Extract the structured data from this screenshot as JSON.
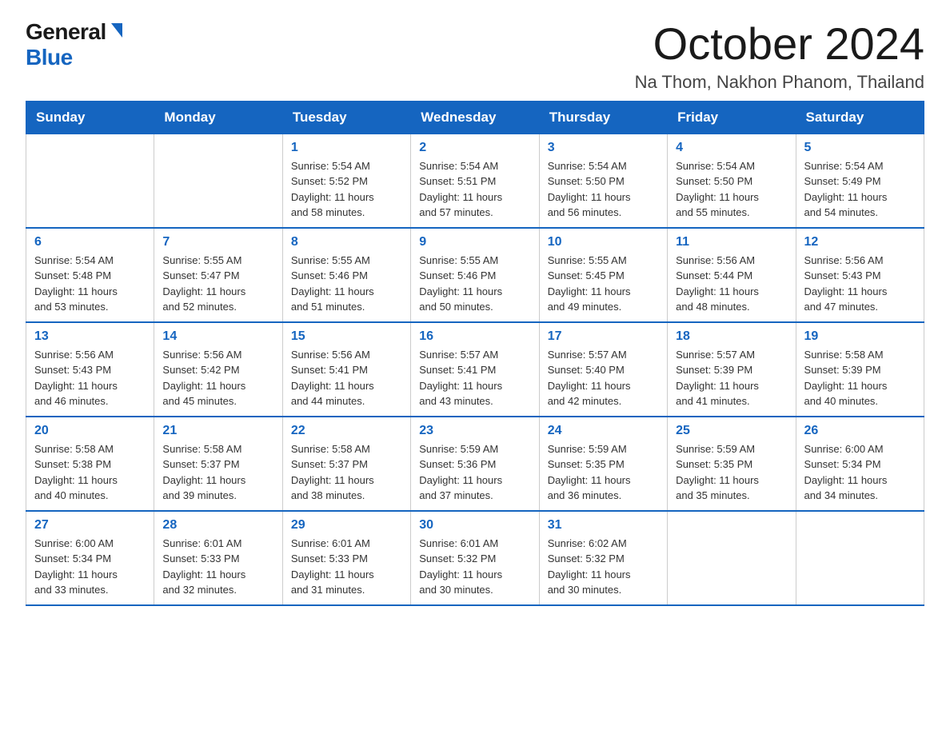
{
  "logo": {
    "general": "General",
    "blue": "Blue"
  },
  "header": {
    "month": "October 2024",
    "location": "Na Thom, Nakhon Phanom, Thailand"
  },
  "days_of_week": [
    "Sunday",
    "Monday",
    "Tuesday",
    "Wednesday",
    "Thursday",
    "Friday",
    "Saturday"
  ],
  "weeks": [
    [
      {
        "day": "",
        "info": ""
      },
      {
        "day": "",
        "info": ""
      },
      {
        "day": "1",
        "info": "Sunrise: 5:54 AM\nSunset: 5:52 PM\nDaylight: 11 hours\nand 58 minutes."
      },
      {
        "day": "2",
        "info": "Sunrise: 5:54 AM\nSunset: 5:51 PM\nDaylight: 11 hours\nand 57 minutes."
      },
      {
        "day": "3",
        "info": "Sunrise: 5:54 AM\nSunset: 5:50 PM\nDaylight: 11 hours\nand 56 minutes."
      },
      {
        "day": "4",
        "info": "Sunrise: 5:54 AM\nSunset: 5:50 PM\nDaylight: 11 hours\nand 55 minutes."
      },
      {
        "day": "5",
        "info": "Sunrise: 5:54 AM\nSunset: 5:49 PM\nDaylight: 11 hours\nand 54 minutes."
      }
    ],
    [
      {
        "day": "6",
        "info": "Sunrise: 5:54 AM\nSunset: 5:48 PM\nDaylight: 11 hours\nand 53 minutes."
      },
      {
        "day": "7",
        "info": "Sunrise: 5:55 AM\nSunset: 5:47 PM\nDaylight: 11 hours\nand 52 minutes."
      },
      {
        "day": "8",
        "info": "Sunrise: 5:55 AM\nSunset: 5:46 PM\nDaylight: 11 hours\nand 51 minutes."
      },
      {
        "day": "9",
        "info": "Sunrise: 5:55 AM\nSunset: 5:46 PM\nDaylight: 11 hours\nand 50 minutes."
      },
      {
        "day": "10",
        "info": "Sunrise: 5:55 AM\nSunset: 5:45 PM\nDaylight: 11 hours\nand 49 minutes."
      },
      {
        "day": "11",
        "info": "Sunrise: 5:56 AM\nSunset: 5:44 PM\nDaylight: 11 hours\nand 48 minutes."
      },
      {
        "day": "12",
        "info": "Sunrise: 5:56 AM\nSunset: 5:43 PM\nDaylight: 11 hours\nand 47 minutes."
      }
    ],
    [
      {
        "day": "13",
        "info": "Sunrise: 5:56 AM\nSunset: 5:43 PM\nDaylight: 11 hours\nand 46 minutes."
      },
      {
        "day": "14",
        "info": "Sunrise: 5:56 AM\nSunset: 5:42 PM\nDaylight: 11 hours\nand 45 minutes."
      },
      {
        "day": "15",
        "info": "Sunrise: 5:56 AM\nSunset: 5:41 PM\nDaylight: 11 hours\nand 44 minutes."
      },
      {
        "day": "16",
        "info": "Sunrise: 5:57 AM\nSunset: 5:41 PM\nDaylight: 11 hours\nand 43 minutes."
      },
      {
        "day": "17",
        "info": "Sunrise: 5:57 AM\nSunset: 5:40 PM\nDaylight: 11 hours\nand 42 minutes."
      },
      {
        "day": "18",
        "info": "Sunrise: 5:57 AM\nSunset: 5:39 PM\nDaylight: 11 hours\nand 41 minutes."
      },
      {
        "day": "19",
        "info": "Sunrise: 5:58 AM\nSunset: 5:39 PM\nDaylight: 11 hours\nand 40 minutes."
      }
    ],
    [
      {
        "day": "20",
        "info": "Sunrise: 5:58 AM\nSunset: 5:38 PM\nDaylight: 11 hours\nand 40 minutes."
      },
      {
        "day": "21",
        "info": "Sunrise: 5:58 AM\nSunset: 5:37 PM\nDaylight: 11 hours\nand 39 minutes."
      },
      {
        "day": "22",
        "info": "Sunrise: 5:58 AM\nSunset: 5:37 PM\nDaylight: 11 hours\nand 38 minutes."
      },
      {
        "day": "23",
        "info": "Sunrise: 5:59 AM\nSunset: 5:36 PM\nDaylight: 11 hours\nand 37 minutes."
      },
      {
        "day": "24",
        "info": "Sunrise: 5:59 AM\nSunset: 5:35 PM\nDaylight: 11 hours\nand 36 minutes."
      },
      {
        "day": "25",
        "info": "Sunrise: 5:59 AM\nSunset: 5:35 PM\nDaylight: 11 hours\nand 35 minutes."
      },
      {
        "day": "26",
        "info": "Sunrise: 6:00 AM\nSunset: 5:34 PM\nDaylight: 11 hours\nand 34 minutes."
      }
    ],
    [
      {
        "day": "27",
        "info": "Sunrise: 6:00 AM\nSunset: 5:34 PM\nDaylight: 11 hours\nand 33 minutes."
      },
      {
        "day": "28",
        "info": "Sunrise: 6:01 AM\nSunset: 5:33 PM\nDaylight: 11 hours\nand 32 minutes."
      },
      {
        "day": "29",
        "info": "Sunrise: 6:01 AM\nSunset: 5:33 PM\nDaylight: 11 hours\nand 31 minutes."
      },
      {
        "day": "30",
        "info": "Sunrise: 6:01 AM\nSunset: 5:32 PM\nDaylight: 11 hours\nand 30 minutes."
      },
      {
        "day": "31",
        "info": "Sunrise: 6:02 AM\nSunset: 5:32 PM\nDaylight: 11 hours\nand 30 minutes."
      },
      {
        "day": "",
        "info": ""
      },
      {
        "day": "",
        "info": ""
      }
    ]
  ]
}
